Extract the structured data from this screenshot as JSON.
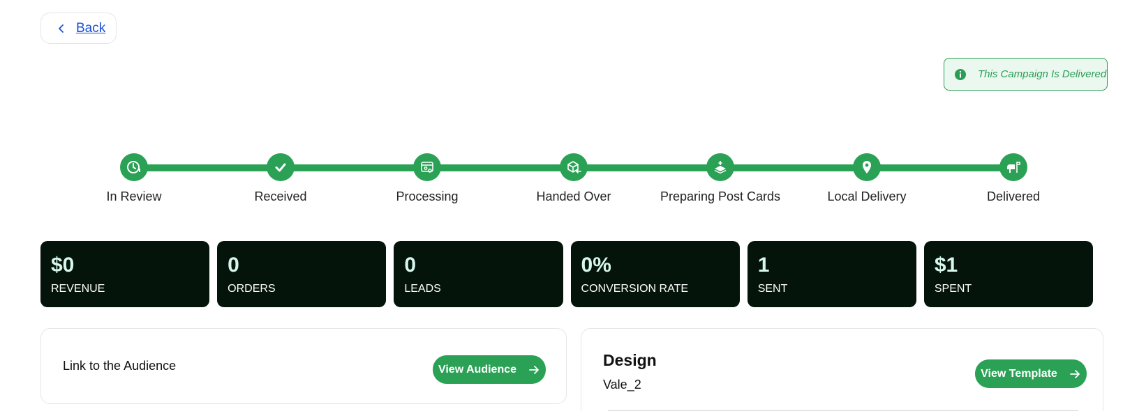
{
  "nav": {
    "back_label": "Back",
    "back_icon": "chevron-left-icon"
  },
  "status": {
    "text": "This Campaign Is Delivered",
    "icon": "info-icon",
    "color": "#2a9d55"
  },
  "steps": [
    {
      "label": "In Review",
      "icon": "clock-icon"
    },
    {
      "label": "Received",
      "icon": "check-icon"
    },
    {
      "label": "Processing",
      "icon": "gear-window-icon"
    },
    {
      "label": "Handed Over",
      "icon": "box-icon"
    },
    {
      "label": "Preparing Post Cards",
      "icon": "postcards-icon"
    },
    {
      "label": "Local Delivery",
      "icon": "map-pin-icon"
    },
    {
      "label": "Delivered",
      "icon": "mailbox-icon"
    }
  ],
  "stats": [
    {
      "value": "$0",
      "label": "REVENUE"
    },
    {
      "value": "0",
      "label": "ORDERS"
    },
    {
      "value": "0",
      "label": "LEADS"
    },
    {
      "value": "0%",
      "label": "CONVERSION RATE"
    },
    {
      "value": "1",
      "label": "SENT"
    },
    {
      "value": "$1",
      "label": "SPENT"
    }
  ],
  "audience": {
    "label": "Link to the Audience",
    "button_label": "View Audience"
  },
  "design": {
    "title": "Design",
    "name": "Vale_2",
    "button_label": "View Template"
  },
  "colors": {
    "accent": "#2aa155",
    "card_bg": "#04140b",
    "stat_value": "#d6f7ec",
    "link": "#1c4fd8"
  }
}
